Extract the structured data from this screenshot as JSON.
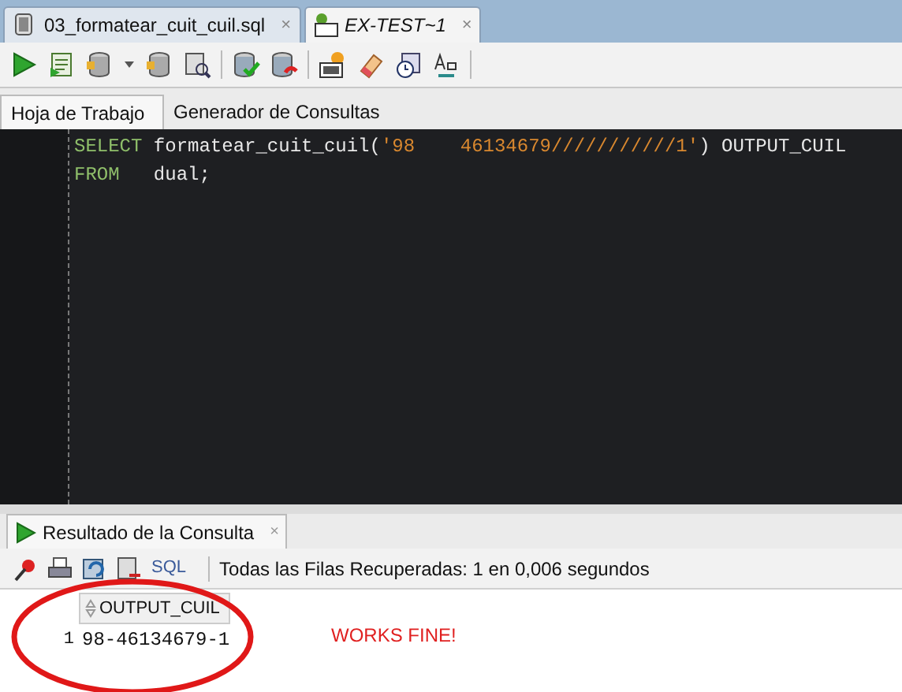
{
  "file_tabs": [
    {
      "label": "03_formatear_cuit_cuil.sql",
      "kind": "sql",
      "selected": false,
      "close": "×"
    },
    {
      "label": "EX-TEST~1",
      "kind": "connection",
      "selected": true,
      "close": "×"
    }
  ],
  "toolbar": {
    "buttons": [
      {
        "kind": "run"
      },
      {
        "kind": "script"
      },
      {
        "kind": "db"
      },
      {
        "kind": "caret"
      },
      {
        "kind": "db"
      },
      {
        "kind": "search"
      },
      {
        "kind": "sep"
      },
      {
        "kind": "commit"
      },
      {
        "kind": "rollback"
      },
      {
        "kind": "sep"
      },
      {
        "kind": "sql"
      },
      {
        "kind": "eraser"
      },
      {
        "kind": "clock"
      },
      {
        "kind": "font"
      },
      {
        "kind": "sep"
      }
    ]
  },
  "worksheet_tabs": [
    {
      "label": "Hoja de Trabajo",
      "selected": true
    },
    {
      "label": "Generador de Consultas",
      "selected": false
    }
  ],
  "editor": {
    "lines": [
      [
        {
          "kind": "keyword",
          "text": "SELECT"
        },
        {
          "kind": "plain",
          "text": " formatear_cuit_cuil("
        },
        {
          "kind": "string",
          "text": "'98    46134679///////////1'"
        },
        {
          "kind": "plain",
          "text": ") OUTPUT_CUIL"
        }
      ],
      [
        {
          "kind": "keyword",
          "text": "FROM"
        },
        {
          "kind": "plain",
          "text": "   dual;"
        }
      ]
    ]
  },
  "result_panel": {
    "tab": {
      "label": "Resultado de la Consulta",
      "close": "×"
    },
    "toolbar": {
      "sql_label": "SQL",
      "status": "Todas las Filas Recuperadas: 1 en 0,006 segundos"
    },
    "grid": {
      "columns": [
        "OUTPUT_CUIL"
      ],
      "rows": [
        {
          "number": "1",
          "cells": [
            "98-46134679-1"
          ]
        }
      ]
    }
  },
  "annotation": {
    "text": "WORKS FINE!"
  }
}
